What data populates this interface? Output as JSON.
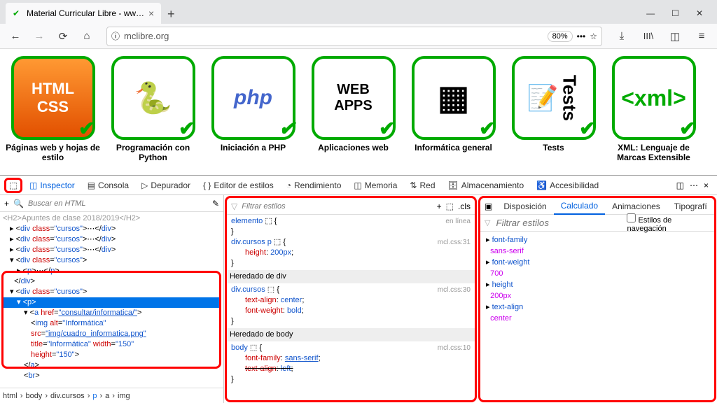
{
  "browser": {
    "tab_title": "Material Curricular Libre - ww…",
    "url": "mclibre.org",
    "zoom": "80%"
  },
  "courses": [
    {
      "line1": "HTML",
      "line2": "CSS",
      "label": "Páginas web y hojas de estilo"
    },
    {
      "label": "Programación con Python"
    },
    {
      "label": "Iniciación a PHP"
    },
    {
      "line1": "WEB",
      "line2": "APPS",
      "label": "Aplicaciones web"
    },
    {
      "label": "Informática general"
    },
    {
      "label": "Tests"
    },
    {
      "label": "XML: Lenguaje de Marcas Extensible"
    }
  ],
  "devtools": {
    "tabs": {
      "inspector": "Inspector",
      "consola": "Consola",
      "depurador": "Depurador",
      "estilos": "Editor de estilos",
      "rendimiento": "Rendimiento",
      "memoria": "Memoria",
      "red": "Red",
      "almacenamiento": "Almacenamiento",
      "accesibilidad": "Accesibilidad"
    },
    "search_placeholder": "Buscar en HTML",
    "filter_styles_placeholder": "Filtrar estilos",
    "cls_label": ".cls",
    "computed_tabs": {
      "disposicion": "Disposición",
      "calculado": "Calculado",
      "animaciones": "Animaciones",
      "tipografia": "Tipografí"
    },
    "nav_checkbox": "Estilos de navegación"
  },
  "html_tree": {
    "truncated": "<H2>Apuntes de clase 2018/2019</H2>",
    "div_cursos": "class",
    "div_cursos_v": "\"cursos\"",
    "ellipsis": "⋯",
    "p_tag": "<p>",
    "a_href_attr": "href",
    "a_href_val": "\"consultar/informatica/\"",
    "img_alt_attr": "alt",
    "img_alt_val": "\"Informática\"",
    "src_attr": "src",
    "src_val": "\"img/cuadro_informatica.png\"",
    "title_attr": "title",
    "title_val": "\"Informática\"",
    "width_attr": "width",
    "width_val": "\"150\"",
    "height_attr": "height",
    "height_val": "\"150\""
  },
  "breadcrumbs": [
    "html",
    "body",
    "div.cursos",
    "p",
    "a",
    "img"
  ],
  "rules": {
    "elemento": "elemento",
    "en_linea": "en línea",
    "div_cursos_p": "div.cursos p",
    "src1": "mcl.css:31",
    "height_prop": "height",
    "height_val": "200px",
    "heredado_div": "Heredado de div",
    "div_cursos": "div.cursos",
    "src2": "mcl.css:30",
    "text_align_prop": "text-align",
    "text_align_val": "center",
    "font_weight_prop": "font-weight",
    "font_weight_val": "bold",
    "heredado_body": "Heredado de body",
    "body": "body",
    "src3": "mcl.css:10",
    "font_family_prop": "font-family",
    "font_family_val": "sans-serif",
    "text_align_struck": "left"
  },
  "computed": {
    "font_family": {
      "name": "font-family",
      "value": "sans-serif"
    },
    "font_weight": {
      "name": "font-weight",
      "value": "700"
    },
    "height": {
      "name": "height",
      "value": "200px"
    },
    "text_align": {
      "name": "text-align",
      "value": "center"
    }
  }
}
